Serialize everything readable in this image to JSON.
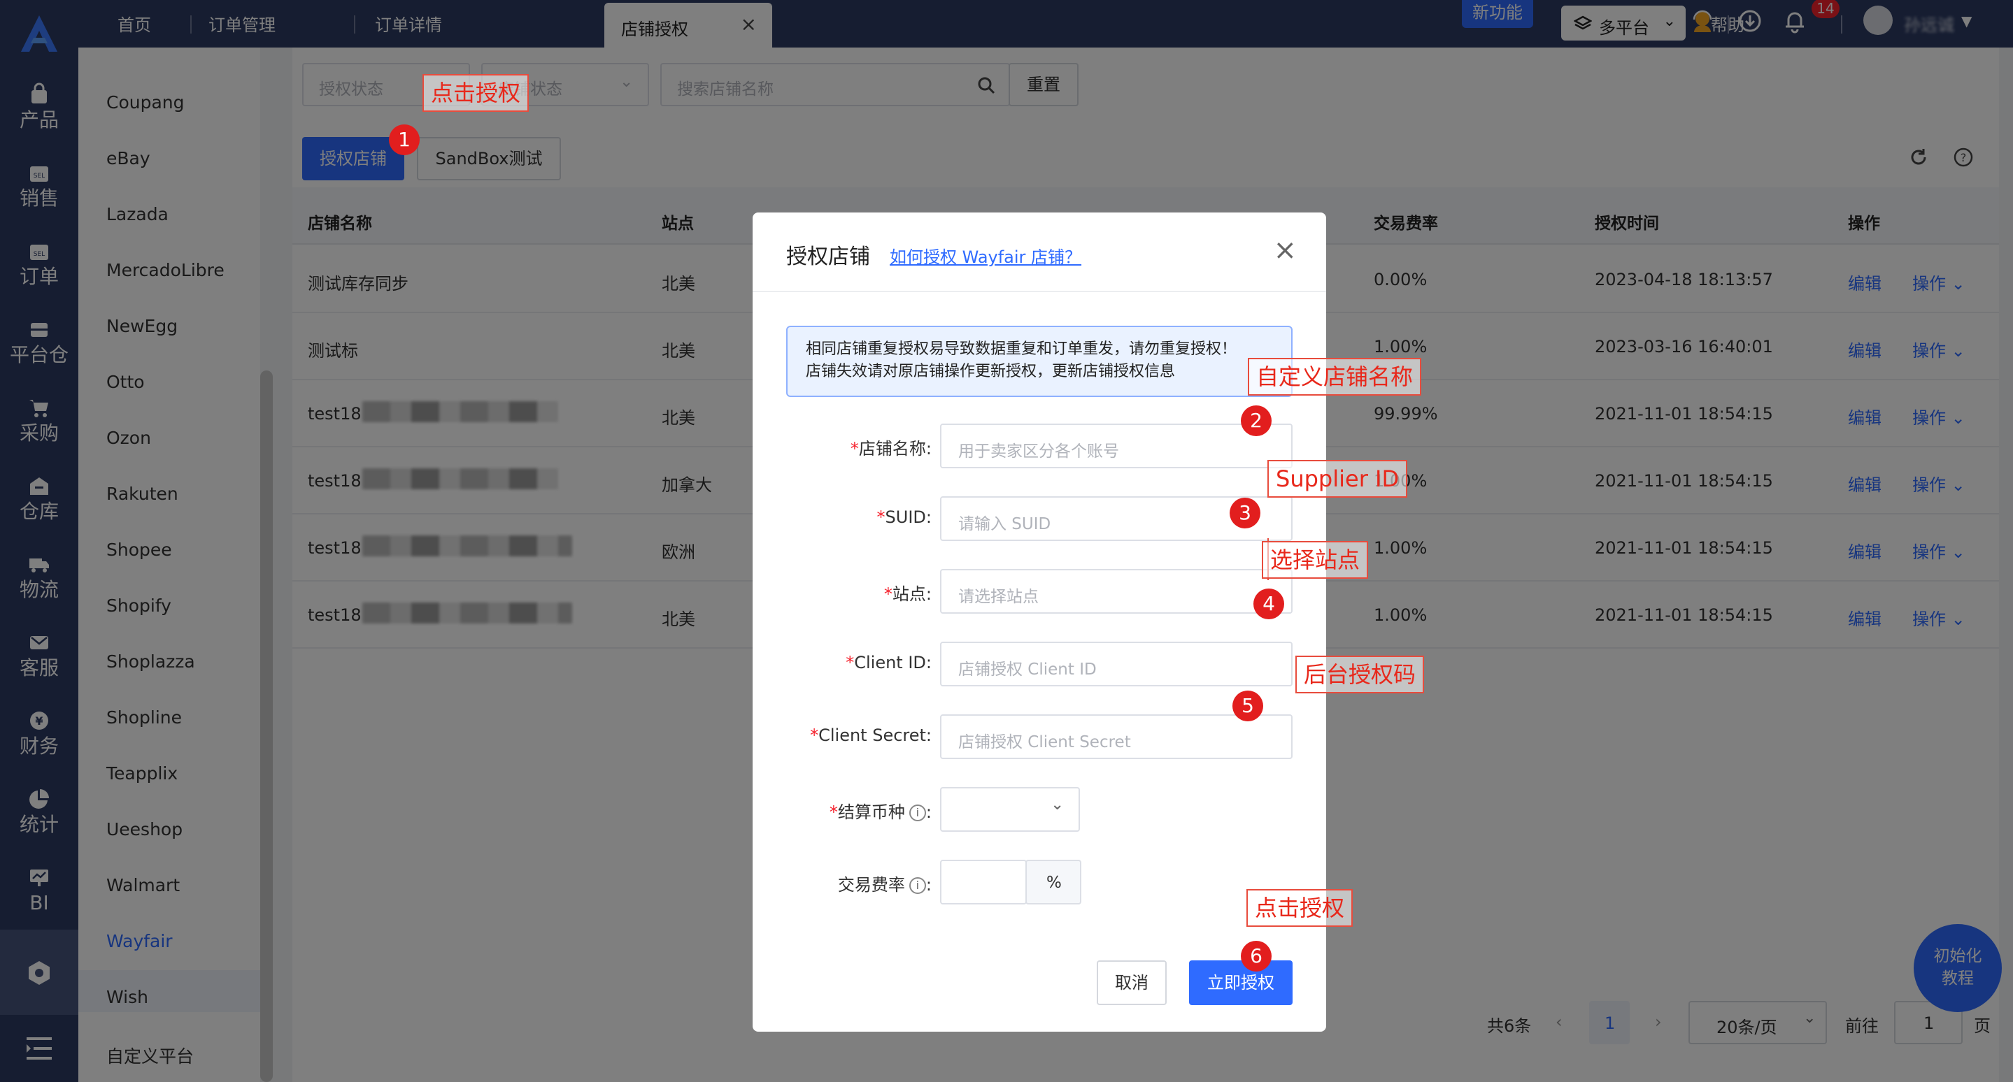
{
  "rail": {
    "items": [
      {
        "label": "产品",
        "icon": "bag-icon"
      },
      {
        "label": "销售",
        "icon": "sell-icon"
      },
      {
        "label": "订单",
        "icon": "order-icon"
      },
      {
        "label": "平台仓",
        "icon": "platform-warehouse-icon"
      },
      {
        "label": "采购",
        "icon": "cart-icon"
      },
      {
        "label": "仓库",
        "icon": "warehouse-icon"
      },
      {
        "label": "物流",
        "icon": "truck-icon"
      },
      {
        "label": "客服",
        "icon": "mail-icon"
      },
      {
        "label": "财务",
        "icon": "yen-icon"
      },
      {
        "label": "统计",
        "icon": "pie-chart-icon"
      },
      {
        "label": "BI",
        "icon": "bi-icon"
      }
    ]
  },
  "topbar": {
    "tabs": [
      "首页",
      "订单管理",
      "订单详情"
    ],
    "active_tab": "店铺授权",
    "new_feature": "新功能",
    "platform": "多平台",
    "help": "帮助",
    "notifications": "14",
    "username": "孙远诚"
  },
  "sidebar": {
    "items": [
      "Coupang",
      "eBay",
      "Lazada",
      "MercadoLibre",
      "NewEgg",
      "Otto",
      "Ozon",
      "Rakuten",
      "Shopee",
      "Shopify",
      "Shoplazza",
      "Shopline",
      "Teapplix",
      "Ueeshop",
      "Walmart",
      "Wayfair",
      "Wish",
      "自定义平台"
    ],
    "active": "Wayfair"
  },
  "filters": {
    "auth_status": "授权状态",
    "store_status": "店铺状态",
    "search_placeholder": "搜索店铺名称",
    "reset": "重置"
  },
  "actions": {
    "authorize": "授权店铺",
    "sandbox": "SandBox测试"
  },
  "table": {
    "headers": [
      "店铺名称",
      "站点",
      "交易费率",
      "授权时间",
      "操作"
    ],
    "rows": [
      {
        "name": "测试库存同步",
        "site": "北美",
        "rate": "0.00%",
        "time": "2023-04-18 18:13:57"
      },
      {
        "name": "测试标",
        "site": "北美",
        "rate": "1.00%",
        "time": "2023-03-16 16:40:01"
      },
      {
        "name": "test18",
        "site": "北美",
        "rate": "99.99%",
        "time": "2021-11-01 18:54:15"
      },
      {
        "name": "test18",
        "site": "加拿大",
        "rate": "1.00%",
        "time": "2021-11-01 18:54:15"
      },
      {
        "name": "test18",
        "site": "欧洲",
        "rate": "1.00%",
        "time": "2021-11-01 18:54:15"
      },
      {
        "name": "test18",
        "site": "北美",
        "rate": "1.00%",
        "time": "2021-11-01 18:54:15"
      }
    ],
    "edit": "编辑",
    "more": "操作"
  },
  "pagination": {
    "total": "共6条",
    "page": "1",
    "per_page": "20条/页",
    "goto": "前往",
    "goto_value": "1",
    "page_unit": "页"
  },
  "tutorial": {
    "line1": "初始化",
    "line2": "教程"
  },
  "modal": {
    "title": "授权店铺",
    "help_link": "如何授权 Wayfair 店铺？",
    "alert_line1": "相同店铺重复授权易导致数据重复和订单重发，请勿重复授权！",
    "alert_line2": "店铺失效请对原店铺操作更新授权，更新店铺授权信息",
    "fields": [
      {
        "label": "店铺名称:",
        "placeholder": "用于卖家区分各个账号",
        "required": "*"
      },
      {
        "label": "SUID:",
        "placeholder": "请输入 SUID",
        "required": "*"
      },
      {
        "label": "站点:",
        "placeholder": "请选择站点",
        "required": "*"
      },
      {
        "label": "Client ID:",
        "placeholder": "店铺授权 Client ID",
        "required": "*"
      },
      {
        "label": "Client Secret:",
        "placeholder": "店铺授权 Client Secret",
        "required": "*"
      }
    ],
    "currency_label": "结算币种",
    "fee_label": "交易费率",
    "percent": "%",
    "cancel": "取消",
    "submit": "立即授权"
  },
  "annotations": {
    "a1": "点击授权",
    "a2": "自定义店铺名称",
    "a3": "Supplier ID",
    "a4": "选择站点",
    "a5": "后台授权码",
    "a6": "点击授权",
    "n1": "1",
    "n2": "2",
    "n3": "3",
    "n4": "4",
    "n5": "5",
    "n6": "6"
  },
  "colors": {
    "rail": "#2c3a63",
    "primary": "#2f6bff",
    "annotation": "#e8281b"
  }
}
